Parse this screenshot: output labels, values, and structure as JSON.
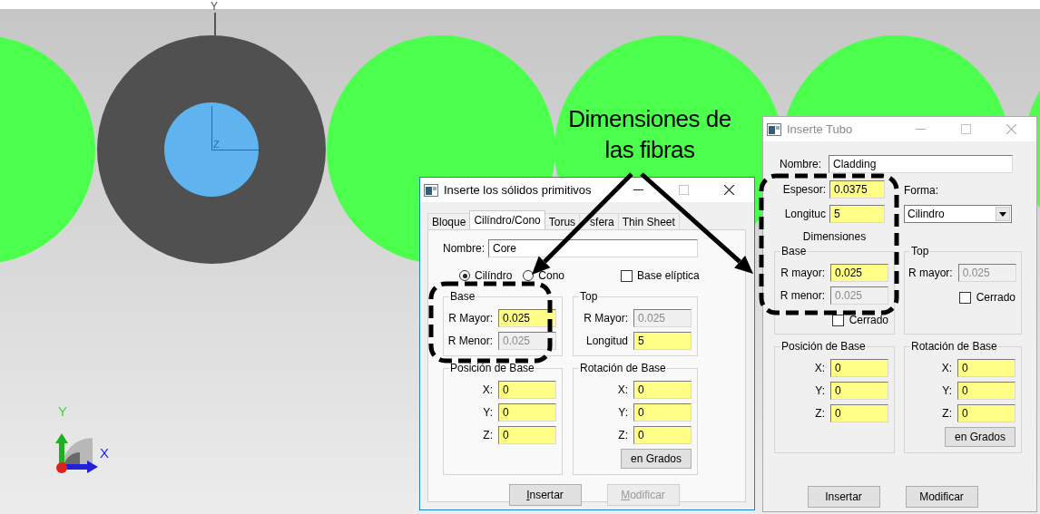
{
  "viewport": {
    "axis_labels": [
      {
        "text": "Y"
      },
      {
        "text": "Z"
      }
    ],
    "triad": {
      "y_label": "Y",
      "x_label": "X"
    }
  },
  "annotation": {
    "lines": [
      "Dimensiones de",
      "las fibras"
    ]
  },
  "primitives_dialog": {
    "title": "Inserte los sólidos primitivos",
    "active": true,
    "accelerators_shown": true,
    "tabs": [
      {
        "label": "Bloque",
        "selected": false
      },
      {
        "label": "Cilíndro/Cono",
        "selected": true
      },
      {
        "label": "Torus",
        "selected": false
      },
      {
        "label": "sfera",
        "selected": false
      },
      {
        "label": "Thin Sheet",
        "selected": false
      }
    ],
    "name_field": {
      "label": "Nombre:",
      "value": "Core"
    },
    "shape_options": [
      {
        "label": "Cilíndro",
        "selected": true
      },
      {
        "label": "Cono",
        "selected": false
      }
    ],
    "elliptic_base": {
      "label": "Base elíptica",
      "checked": false
    },
    "groups": [
      {
        "title": "Base",
        "fields": [
          {
            "label": "R Mayor:",
            "value": "0.025",
            "enabled": true
          },
          {
            "label": "R Menor:",
            "value": "0.025",
            "enabled": false
          }
        ]
      },
      {
        "title": "Top",
        "fields": [
          {
            "label": "R Mayor:",
            "value": "0.025",
            "enabled": false
          },
          {
            "label": "Longitud",
            "value": "5",
            "enabled": true
          }
        ]
      },
      {
        "title": "Posición de Base",
        "fields": [
          {
            "label": "X:",
            "value": "0",
            "enabled": true
          },
          {
            "label": "Y:",
            "value": "0",
            "enabled": true
          },
          {
            "label": "Z:",
            "value": "0",
            "enabled": true
          }
        ]
      },
      {
        "title": "Rotación de Base",
        "fields": [
          {
            "label": "X:",
            "value": "0",
            "enabled": true
          },
          {
            "label": "Y:",
            "value": "0",
            "enabled": true
          },
          {
            "label": "Z:",
            "value": "0",
            "enabled": true
          }
        ],
        "button": "en Grados"
      }
    ],
    "buttons": [
      {
        "label": "Insertar",
        "disabled": false
      },
      {
        "label": "Modificar",
        "disabled": true
      }
    ]
  },
  "tube_dialog": {
    "title": "Inserte Tubo",
    "active": false,
    "accelerators_shown": false,
    "name_field": {
      "label": "Nombre:",
      "value": "Cladding"
    },
    "params": [
      {
        "label": "Espesor:",
        "value": "0.0375",
        "enabled": true
      },
      {
        "label": "Longituc",
        "value": "5",
        "enabled": true
      }
    ],
    "shape": {
      "label": "Forma:",
      "value": "Cilindro"
    },
    "dimensions_label": "Dimensiones",
    "groups": [
      {
        "title": "Base",
        "fields": [
          {
            "label": "R mayor:",
            "value": "0.025",
            "enabled": true
          },
          {
            "label": "R menor:",
            "value": "0.025",
            "enabled": false
          }
        ],
        "checkbox": {
          "label": "Cerrado",
          "checked": false
        }
      },
      {
        "title": "Top",
        "fields": [
          {
            "label": "R mayor:",
            "value": "0.025",
            "enabled": false
          }
        ],
        "checkbox": {
          "label": "Cerrado",
          "checked": false
        }
      },
      {
        "title": "Posición de Base",
        "fields": [
          {
            "label": "X:",
            "value": "0",
            "enabled": true
          },
          {
            "label": "Y:",
            "value": "0",
            "enabled": true
          },
          {
            "label": "Z:",
            "value": "0",
            "enabled": true
          }
        ]
      },
      {
        "title": "Rotación de Base",
        "fields": [
          {
            "label": "X:",
            "value": "0",
            "enabled": true
          },
          {
            "label": "Y:",
            "value": "0",
            "enabled": true
          },
          {
            "label": "Z:",
            "value": "0",
            "enabled": true
          }
        ],
        "button": "en Grados"
      }
    ],
    "buttons": [
      {
        "label": "Insertar",
        "disabled": false
      },
      {
        "label": "Modificar",
        "disabled": false
      }
    ]
  }
}
